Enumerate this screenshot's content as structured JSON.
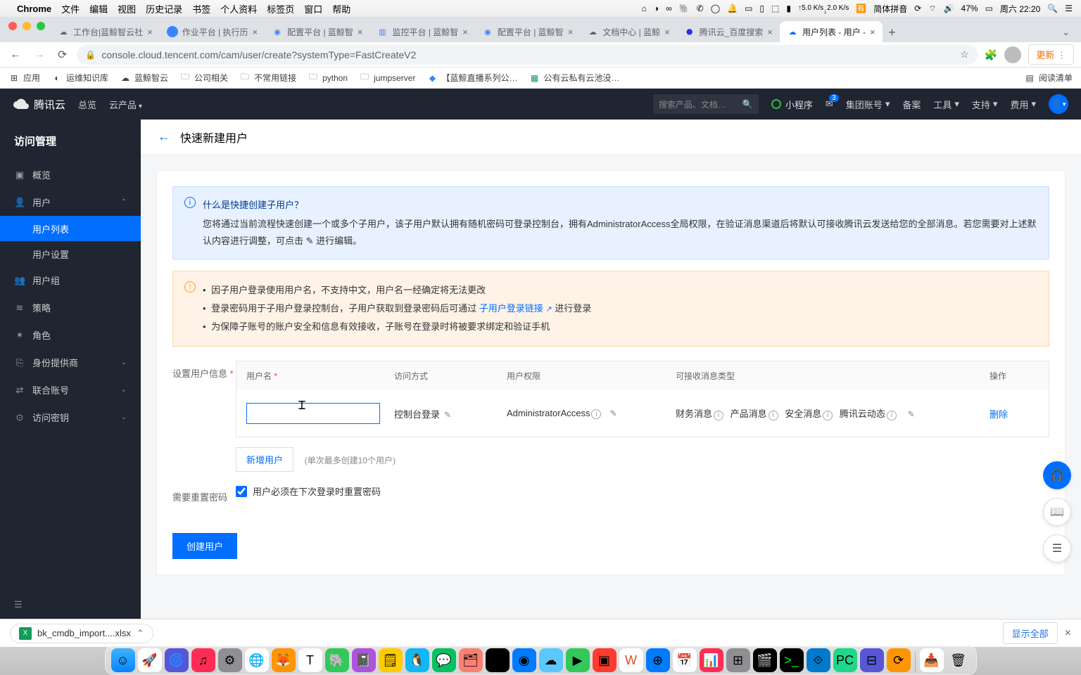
{
  "menubar": {
    "app": "Chrome",
    "items": [
      "文件",
      "编辑",
      "视图",
      "历史记录",
      "书签",
      "个人资料",
      "标签页",
      "窗口",
      "帮助"
    ],
    "ime": "简体拼音",
    "battery": "47%",
    "clock": "周六 22:20",
    "net_up": "5.0 K/s",
    "net_dn": "2.0 K/s"
  },
  "tabs": [
    {
      "title": "工作台|蓝鲸智云社"
    },
    {
      "title": "作业平台 | 执行历"
    },
    {
      "title": "配置平台 | 蓝鲸智"
    },
    {
      "title": "监控平台 | 蓝鲸智"
    },
    {
      "title": "配置平台 | 蓝鲸智"
    },
    {
      "title": "文档中心 | 蓝鲸"
    },
    {
      "title": "腾讯云_百度搜索"
    },
    {
      "title": "用户列表 - 用户 - ",
      "active": true
    }
  ],
  "url": "console.cloud.tencent.com/cam/user/create?systemType=FastCreateV2",
  "update_btn": "更新 ⋮",
  "bookmarks": {
    "apps": "应用",
    "items": [
      "运维知识库",
      "蓝鲸智云",
      "公司相关",
      "不常用链接",
      "python",
      "jumpserver",
      "【蓝鲸直播系列公…",
      "公有云私有云池没…"
    ],
    "reading": "阅读清单"
  },
  "tc": {
    "brand": "腾讯云",
    "nav": [
      "总览",
      "云产品"
    ],
    "search_ph": "搜索产品、文档…",
    "mini": "小程序",
    "badge": "3",
    "rnav": [
      "集团账号",
      "备案",
      "工具",
      "支持",
      "费用"
    ]
  },
  "sidebar": {
    "title": "访问管理",
    "items": [
      {
        "icon": "▣",
        "label": "概览"
      },
      {
        "icon": "👤",
        "label": "用户",
        "expand": true,
        "subs": [
          {
            "label": "用户列表",
            "active": true
          },
          {
            "label": "用户设置"
          }
        ]
      },
      {
        "icon": "👥",
        "label": "用户组"
      },
      {
        "icon": "≋",
        "label": "策略"
      },
      {
        "icon": "✶",
        "label": "角色"
      },
      {
        "icon": "⎘",
        "label": "身份提供商",
        "chev": true
      },
      {
        "icon": "⇄",
        "label": "联合账号",
        "chev": true
      },
      {
        "icon": "🔑",
        "label": "访问密钥",
        "chev": true
      }
    ]
  },
  "page": {
    "title": "快速新建用户",
    "info_title": "什么是快捷创建子用户？",
    "info_body": "您将通过当前流程快速创建一个或多个子用户，该子用户默认拥有随机密码可登录控制台，拥有AdministratorAccess全局权限，在验证消息渠道后将默认可接收腾讯云发送给您的全部消息。若您需要对上述默认内容进行调整，可点击 ✎ 进行编辑。",
    "warn": [
      "因子用户登录使用用户名，不支持中文，用户名一经确定将无法更改",
      "登录密码用于子用户登录控制台，子用户获取到登录密码后可通过 ",
      "为保障子账号的账户安全和信息有效接收，子账号在登录时将被要求绑定和验证手机"
    ],
    "warn_link": "子用户登录链接",
    "warn_after": " 进行登录",
    "form_label": "设置用户信息",
    "cols": {
      "name": "用户名",
      "access": "访问方式",
      "perm": "用户权限",
      "msg": "可接收消息类型",
      "op": "操作"
    },
    "row": {
      "access": "控制台登录",
      "perm": "AdministratorAccess",
      "msgs": [
        "财务消息",
        "产品消息",
        "安全消息",
        "腾讯云动态"
      ],
      "delete": "删除"
    },
    "add_btn": "新增用户",
    "add_hint": "(单次最多创建10个用户)",
    "reset_label": "需要重置密码",
    "reset_check": "用户必须在下次登录时重置密码",
    "submit": "创建用户"
  },
  "dl": {
    "file": "bk_cmdb_import....xlsx",
    "showall": "显示全部"
  }
}
